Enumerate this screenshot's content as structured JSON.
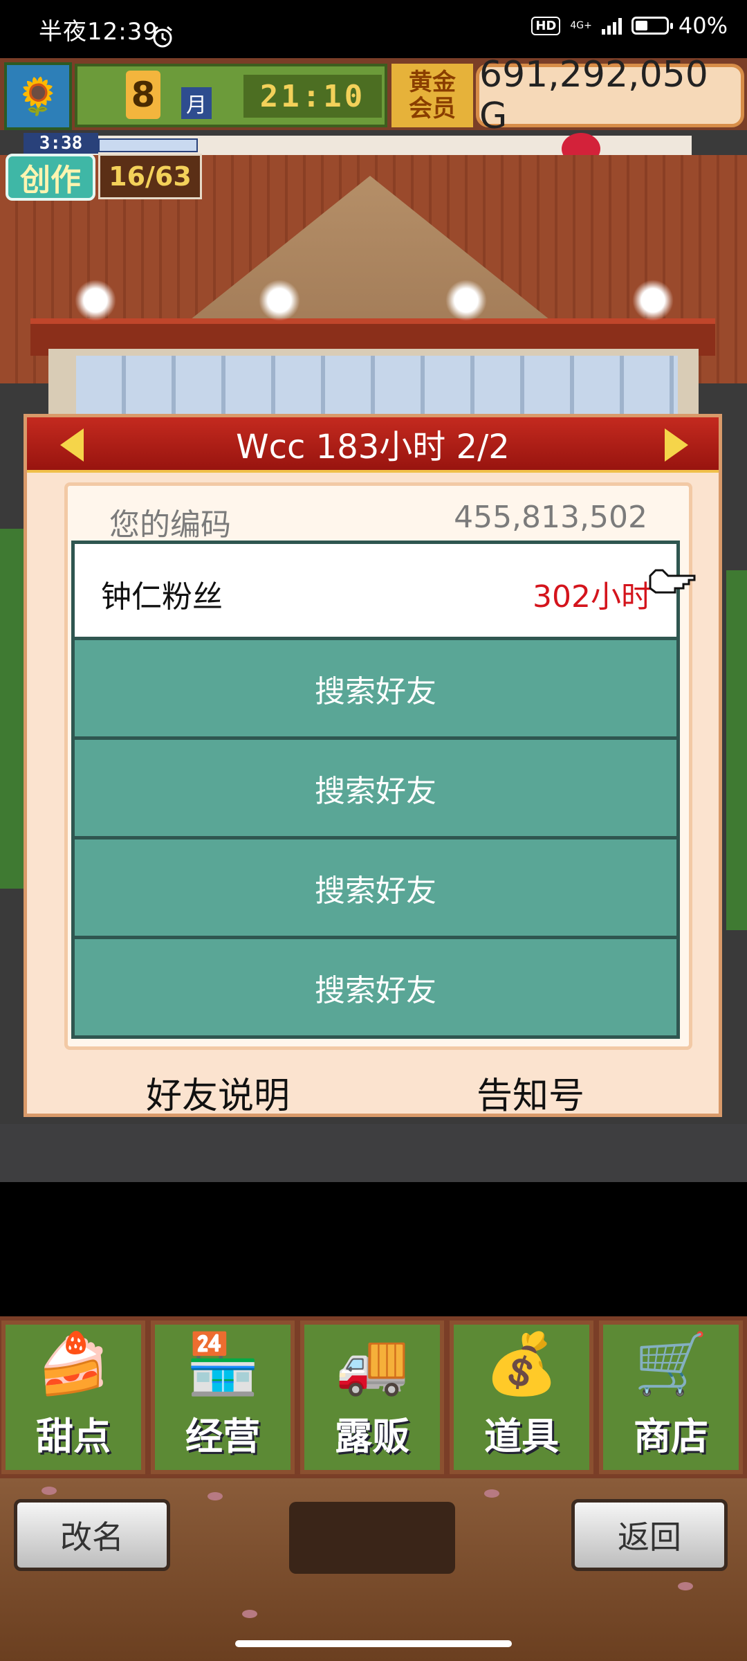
{
  "status_bar": {
    "time": "半夜12:39",
    "hd": "HD",
    "network": "4G+",
    "battery": "40%",
    "battery_level": 0.4
  },
  "hud": {
    "month_number": "8",
    "month_label": "月",
    "clock": "21:10",
    "gold_badge_line1": "黄金",
    "gold_badge_line2": "会员",
    "money": "691,292,050 G",
    "create_timer": "3:38",
    "create_label": "创作",
    "create_count": "16/63"
  },
  "dialog": {
    "title": "Wcc  183小时 2/2",
    "code_label": "您的编码",
    "code_value": "455,813,502",
    "friends": [
      {
        "name": "钟仁粉丝",
        "hours": "302小时"
      }
    ],
    "search_slots": [
      "搜索好友",
      "搜索好友",
      "搜索好友",
      "搜索好友"
    ],
    "help_left": "好友说明",
    "help_right": "告知号"
  },
  "menu": {
    "items": [
      {
        "label": "甜点",
        "icon": "cake-icon"
      },
      {
        "label": "经营",
        "icon": "shop-icon"
      },
      {
        "label": "露贩",
        "icon": "food-truck-icon"
      },
      {
        "label": "道具",
        "icon": "item-bag-icon"
      },
      {
        "label": "商店",
        "icon": "cart-icon"
      }
    ]
  },
  "footer": {
    "rename": "改名",
    "back": "返回"
  },
  "colors": {
    "dialog_header": "#c42a1f",
    "friend_slot": "#5aa696",
    "hours_text": "#d4141c",
    "hud_green": "#6c9b3a"
  }
}
